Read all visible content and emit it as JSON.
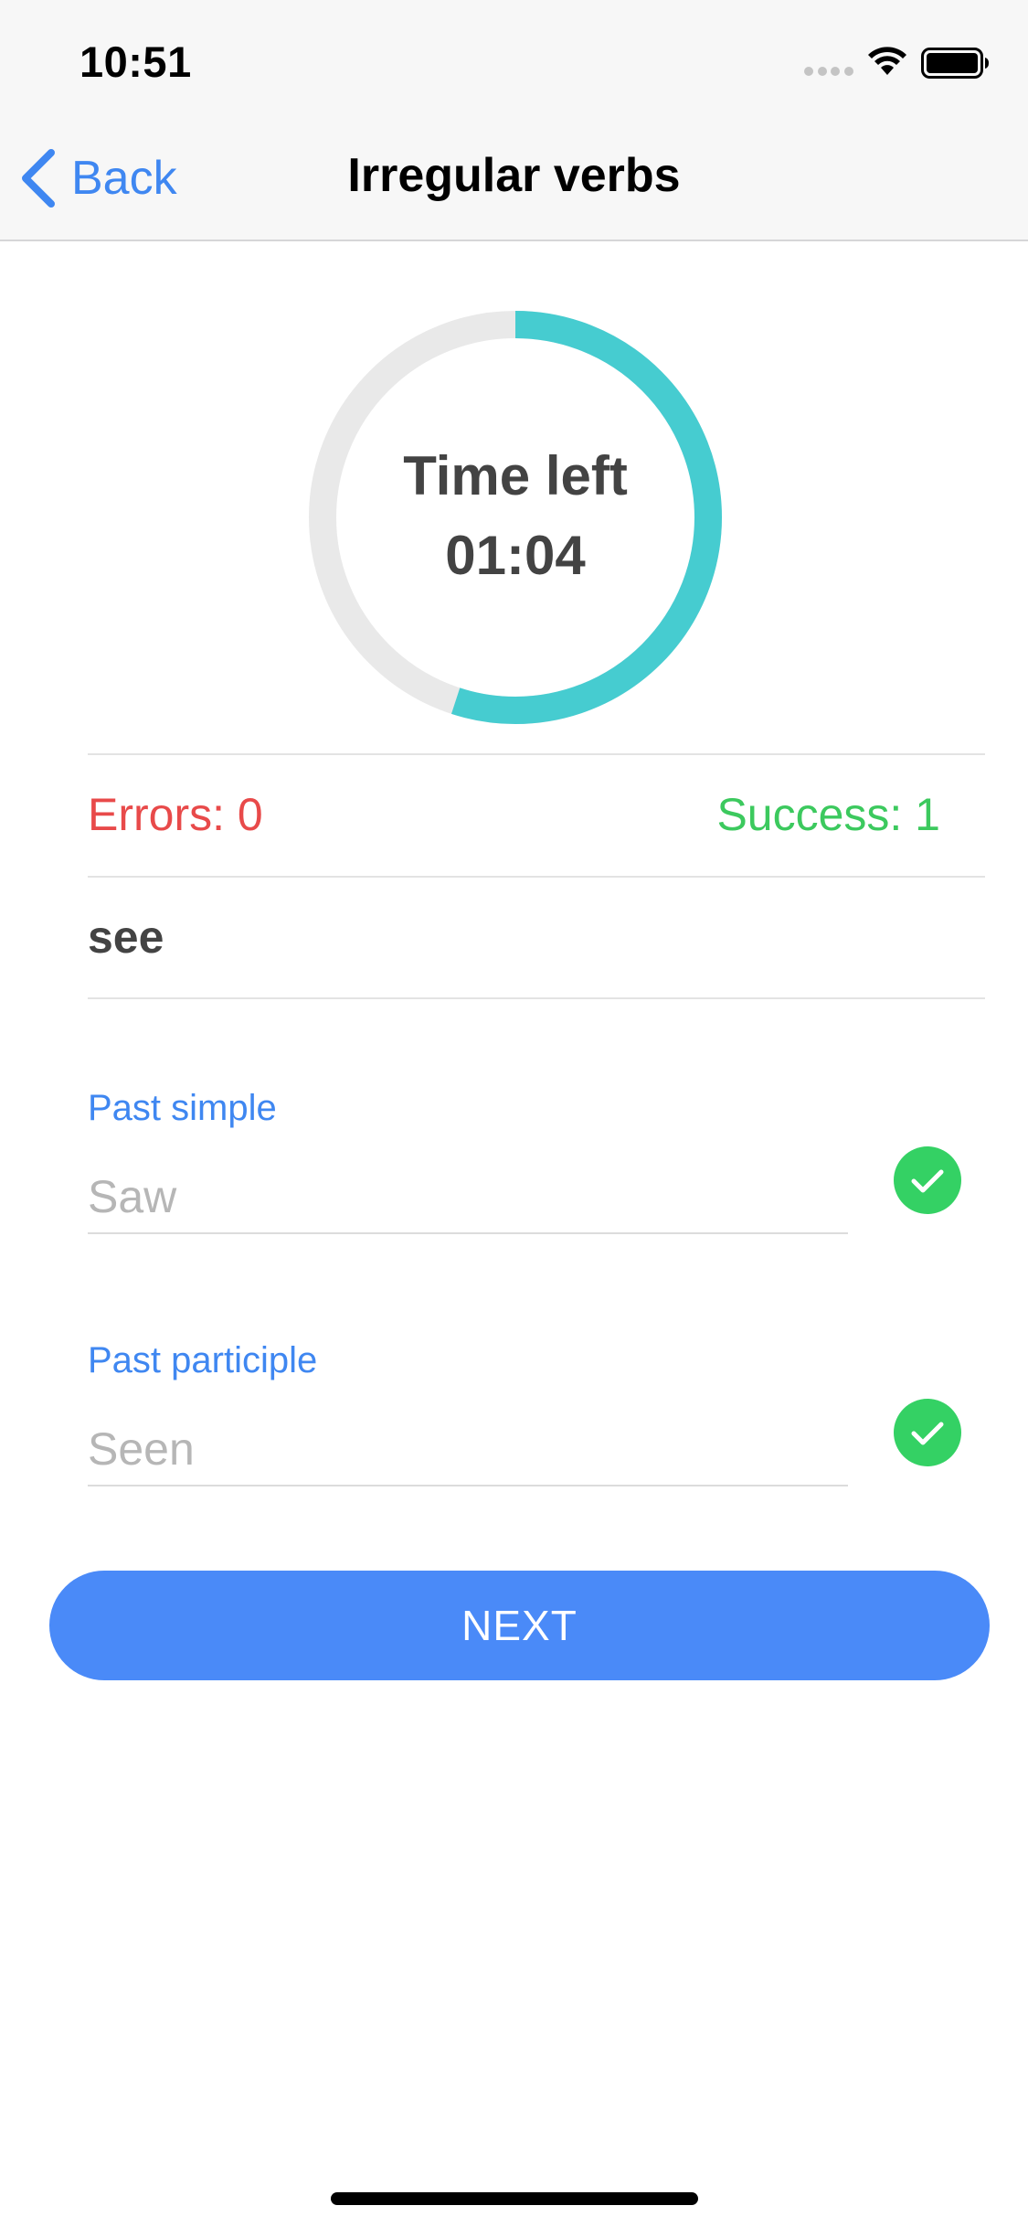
{
  "status_bar": {
    "time": "10:51"
  },
  "nav": {
    "back_label": "Back",
    "title": "Irregular verbs"
  },
  "timer": {
    "label": "Time left",
    "value": "01:04",
    "progress_fraction": 0.55,
    "colors": {
      "progress": "#46ccd0",
      "track": "#e9e9e9"
    }
  },
  "score": {
    "errors_label": "Errors: 0",
    "success_label": "Success: 1",
    "colors": {
      "errors": "#e84a4a",
      "success": "#3cc95e"
    }
  },
  "verb": "see",
  "fields": [
    {
      "label": "Past simple",
      "placeholder": "Saw",
      "status": "correct"
    },
    {
      "label": "Past participle",
      "placeholder": "Seen",
      "status": "correct"
    }
  ],
  "next_button": {
    "label": "NEXT",
    "color": "#4a8af8"
  },
  "icons": {
    "back": "chevron-left-icon",
    "wifi": "wifi-icon",
    "battery": "battery-icon",
    "check": "checkmark-circle-icon"
  }
}
